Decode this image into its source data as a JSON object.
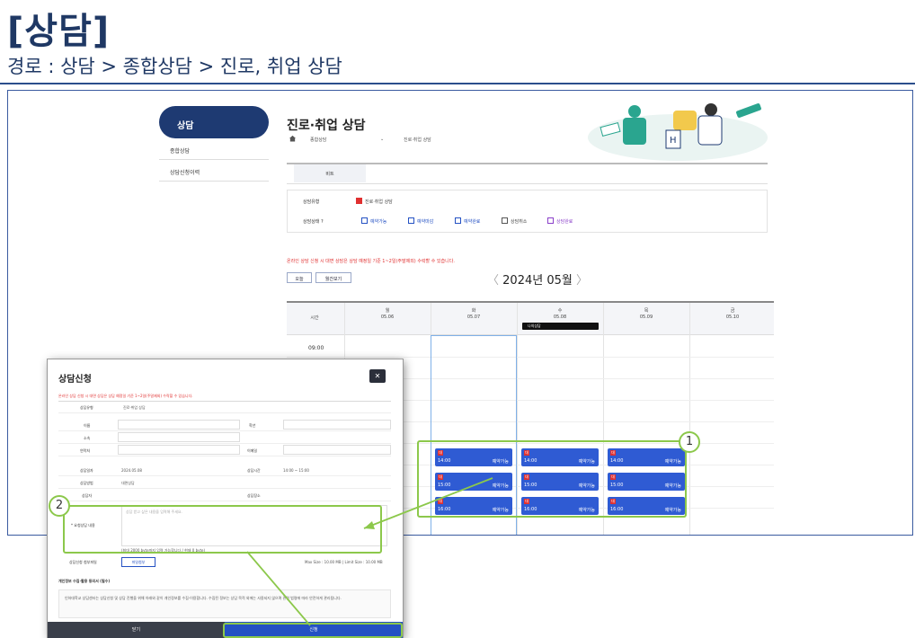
{
  "slide": {
    "title": "[상담]",
    "path": "경로 : 상담 > 종합상담 > 진로, 취업 상담"
  },
  "sidebar": {
    "active": "상담",
    "items": [
      "종합상담",
      "상담신청이력"
    ]
  },
  "page": {
    "title": "진로·취업 상담",
    "breadcrumb_1": "종합상담",
    "breadcrumb_2": "진로·취업 상담",
    "tab": "비트"
  },
  "filters": {
    "type_label": "상담유형",
    "type_value": "진로·취업 상담",
    "status_label": "상담상태 ?",
    "statuses": [
      "예약가능",
      "예약마감",
      "예약완료",
      "상담취소",
      "상담완료"
    ]
  },
  "notice": "온라인 상담 신청 시 대면 상담은 상담 예정일 기준 1~2일(주말제외) 수락할 수 있습니다.",
  "controls": {
    "today_btn": "오늘",
    "month_btn": "월간보기",
    "month_label": "2024년 05월",
    "prev": "〈",
    "next": "〉"
  },
  "calendar": {
    "time_header": "시간",
    "days": [
      {
        "dow": "월",
        "date": "05.06"
      },
      {
        "dow": "화",
        "date": "05.07"
      },
      {
        "dow": "수",
        "date": "05.08"
      },
      {
        "dow": "목",
        "date": "05.09"
      },
      {
        "dow": "금",
        "date": "05.10"
      }
    ],
    "first_time": "09:00",
    "today_badge": "나의상담",
    "slots": [
      {
        "badge": "대",
        "time": "14:00",
        "status": "예약가능"
      },
      {
        "badge": "대",
        "time": "14:00",
        "status": "예약가능"
      },
      {
        "badge": "대",
        "time": "14:00",
        "status": "예약가능"
      },
      {
        "badge": "대",
        "time": "15:00",
        "status": "예약가능"
      },
      {
        "badge": "대",
        "time": "15:00",
        "status": "예약가능"
      },
      {
        "badge": "대",
        "time": "15:00",
        "status": "예약가능"
      },
      {
        "badge": "대",
        "time": "16:00",
        "status": "예약가능"
      },
      {
        "badge": "대",
        "time": "16:00",
        "status": "예약가능"
      },
      {
        "badge": "대",
        "time": "16:00",
        "status": "예약가능"
      }
    ]
  },
  "callouts": {
    "one": "1",
    "two": "2"
  },
  "modal": {
    "title": "상담신청",
    "close": "✕",
    "note": "온라인 상담 신청 시 대면 상담은 상담 예정일 기준 1~2일(주말제외) 수락할 수 있습니다.",
    "type_label": "상담유형",
    "type_value": "진로·취업 상담",
    "name_label": "이름",
    "grade_label": "학년",
    "dept_label": "소속",
    "phone_label": "연락처",
    "email_label": "이메일",
    "date_label": "상담일자",
    "date_value": "2024.05.08",
    "time_label": "상담시간",
    "time_value": "14:00 ~ 15:00",
    "method_label": "상담방법",
    "method_value": "대면상담",
    "place_label": "상담장소",
    "counselor_label": "상담자",
    "request_label": "* 요청상담 내용",
    "request_placeholder": "상담 받고 싶은 내용을 입력해 주세요.",
    "helper": "(최대 2000 byte까지 입력 가능합니다 / 현재 0 byte)",
    "attach_label": "상담신청 첨부파일",
    "attach_btn": "파일첨부",
    "attach_note": "Max Size : 10.00 MB | Limit Size : 10.00 MB",
    "consent_title": "개인정보 수집·활용 동의서 (필수)",
    "consent_text": "인하대학교 상담센터는 상담신청 및 상담 진행을 위해 아래와 같이 개인정보를 수집·이용합니다. 수집된 정보는 상담 목적 외에는 사용되지 않으며 관련 법령에 따라 안전하게 관리됩니다.",
    "cancel": "닫기",
    "submit": "신청"
  }
}
